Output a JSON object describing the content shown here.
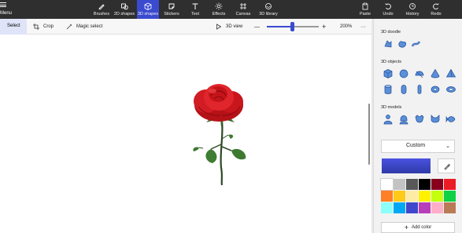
{
  "menu": {
    "label": "Menu"
  },
  "toolbar": {
    "tools": [
      {
        "label": "Brushes",
        "icon": "brush-icon"
      },
      {
        "label": "2D shapes",
        "icon": "2d-shapes-icon"
      },
      {
        "label": "3D shapes",
        "icon": "cube-icon",
        "active": true
      },
      {
        "label": "Stickers",
        "icon": "sticker-icon"
      },
      {
        "label": "Text",
        "icon": "text-icon"
      },
      {
        "label": "Effects",
        "icon": "effects-icon"
      },
      {
        "label": "Canvas",
        "icon": "canvas-icon"
      },
      {
        "label": "3D library",
        "icon": "3d-library-icon"
      }
    ],
    "paste": "Paste",
    "undo": "Undo",
    "history": "History",
    "redo": "Redo"
  },
  "subbar": {
    "select": "Select",
    "crop": "Crop",
    "magic_select": "Magic select",
    "view_3d": "3D view",
    "zoom_minus": "—",
    "zoom_plus": "+",
    "zoom": "200%",
    "more": "···"
  },
  "panel": {
    "doodle_title": "3D doodle",
    "objects_title": "3D objects",
    "models_title": "3D models",
    "material": "Custom",
    "selected_color": "#3a45c8",
    "add_color": "Add color",
    "palette": [
      "#ffffff",
      "#c3c3c3",
      "#585858",
      "#000000",
      "#88001b",
      "#ec1c24",
      "#ff7f27",
      "#ffca18",
      "#fdeca6",
      "#fff200",
      "#c4ff0e",
      "#0ed145",
      "#8cfffb",
      "#00a8f3",
      "#3f48cc",
      "#b83dba",
      "#ffaec8",
      "#b97a56"
    ]
  }
}
